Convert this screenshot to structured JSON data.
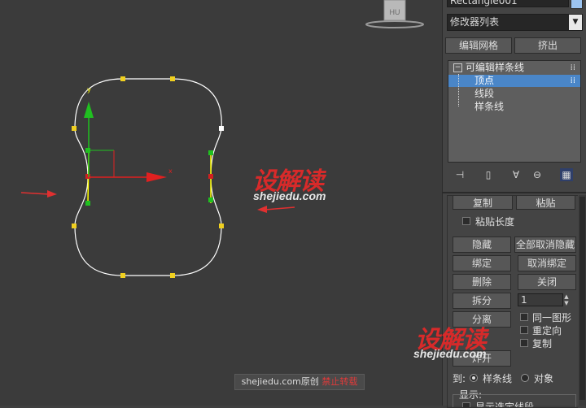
{
  "viewport": {
    "gizmo_label": "HU",
    "axis_y": "y",
    "axis_x": "x",
    "watermark_logo": "设解读",
    "watermark_url": "shejiedu.com",
    "credit_site": "shejiedu.com原创",
    "credit_note": "禁止转载",
    "colors": {
      "spline": "#ffffff",
      "selected_segment": "#ffff00",
      "vertex": "#f0d020",
      "arrow": "#e03030",
      "axis_y": "#20c020",
      "axis_x": "#e02020"
    }
  },
  "panel": {
    "object_name": "Rectangle001",
    "modifier_dropdown": "修改器列表",
    "btn_edit_mesh": "编辑网格",
    "btn_extrude": "挤出",
    "stack": {
      "root": "可编辑样条线",
      "items": [
        "顶点",
        "线段",
        "样条线"
      ],
      "selected": "顶点"
    },
    "stack_tools": [
      "pin-stack-icon",
      "show-end-result-icon",
      "make-unique-icon",
      "remove-modifier-icon",
      "configure-sets-icon"
    ],
    "geometry": {
      "btn_copy": "复制",
      "btn_paste": "粘贴",
      "chk_paste_length": "粘贴长度",
      "btn_hide": "隐藏",
      "btn_unhide_all": "全部取消隐藏",
      "btn_bind": "绑定",
      "btn_unbind": "取消绑定",
      "btn_delete": "删除",
      "btn_close": "关闭",
      "btn_divide": "拆分",
      "divide_value": "1",
      "btn_detach": "分离",
      "chk_same_shape": "同一图形",
      "chk_reorient": "重定向",
      "chk_copy": "复制",
      "btn_explode": "炸开",
      "to_label": "到:",
      "radio_spline": "样条线",
      "radio_object": "对象",
      "display_label": "显示:",
      "chk_show_segments": "显示选定线段"
    }
  }
}
